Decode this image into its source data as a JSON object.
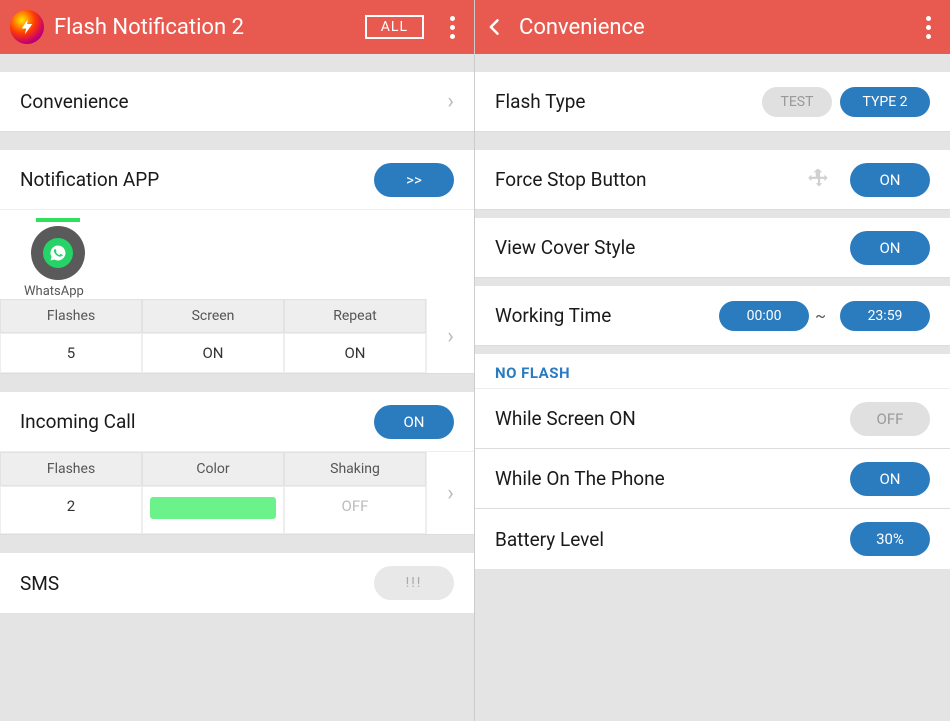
{
  "left": {
    "title": "Flash Notification 2",
    "allBtn": "ALL",
    "convenience": {
      "label": "Convenience"
    },
    "notificationApp": {
      "label": "Notification APP",
      "arrow": ">>"
    },
    "whatsapp": {
      "name": "WhatsApp",
      "headers": [
        "Flashes",
        "Screen",
        "Repeat"
      ],
      "values": [
        "5",
        "ON",
        "ON"
      ]
    },
    "incomingCall": {
      "label": "Incoming Call",
      "toggle": "ON",
      "headers": [
        "Flashes",
        "Color",
        "Shaking"
      ],
      "values": [
        "2",
        "",
        "OFF"
      ]
    },
    "sms": {
      "label": "SMS",
      "btn": "!!!"
    }
  },
  "right": {
    "title": "Convenience",
    "flashType": {
      "label": "Flash Type",
      "test": "TEST",
      "type": "TYPE 2"
    },
    "forceStop": {
      "label": "Force Stop Button",
      "toggle": "ON"
    },
    "viewCover": {
      "label": "View Cover Style",
      "toggle": "ON"
    },
    "workingTime": {
      "label": "Working Time",
      "start": "00:00",
      "end": "23:59",
      "sep": "~"
    },
    "noFlashHeader": "NO FLASH",
    "whileScreen": {
      "label": "While Screen ON",
      "toggle": "OFF"
    },
    "whilePhone": {
      "label": "While On The Phone",
      "toggle": "ON"
    },
    "battery": {
      "label": "Battery Level",
      "value": "30%"
    }
  }
}
